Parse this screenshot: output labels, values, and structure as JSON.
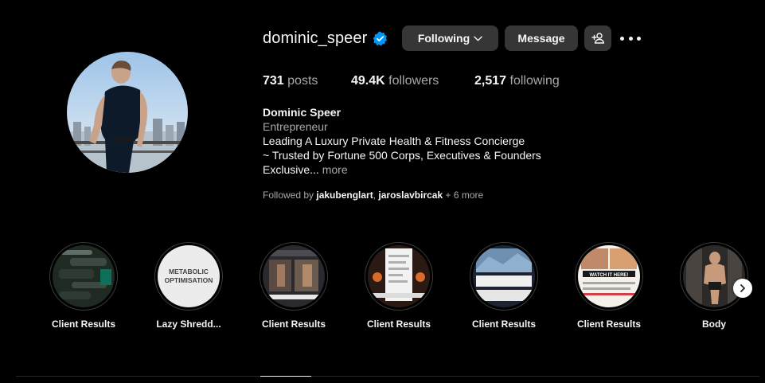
{
  "profile": {
    "username": "dominic_speer",
    "verified_icon": "verified-badge-icon",
    "accent_color": "#0095f6"
  },
  "actions": {
    "following_label": "Following",
    "message_label": "Message",
    "suggest_icon": "add-person-icon",
    "more_icon": "more-options-icon"
  },
  "stats": {
    "posts_count": "731",
    "posts_label": "posts",
    "followers_count": "49.4K",
    "followers_label": "followers",
    "following_count": "2,517",
    "following_label": "following"
  },
  "bio": {
    "full_name": "Dominic Speer",
    "category": "Entrepreneur",
    "line1": "Leading A Luxury Private Health & Fitness Concierge",
    "line2": "~ Trusted by Fortune 500 Corps, Executives & Founders",
    "line3": "Exclusive...",
    "more": "more"
  },
  "followed_by": {
    "prefix": "Followed by",
    "user1": "jakubenglart",
    "separator": ",",
    "user2": "jaroslavbircak",
    "rest": "+ 6 more"
  },
  "highlights": [
    {
      "label": "Client Results"
    },
    {
      "label": "Lazy Shredd...",
      "cover_line1": "METABOLIC",
      "cover_line2": "OPTIMISATION"
    },
    {
      "label": "Client Results"
    },
    {
      "label": "Client Results"
    },
    {
      "label": "Client Results"
    },
    {
      "label": "Client Results",
      "cover_text": "WATCH IT HERE!"
    },
    {
      "label": "Body"
    }
  ],
  "navigation": {
    "next_icon": "chevron-right-icon"
  }
}
